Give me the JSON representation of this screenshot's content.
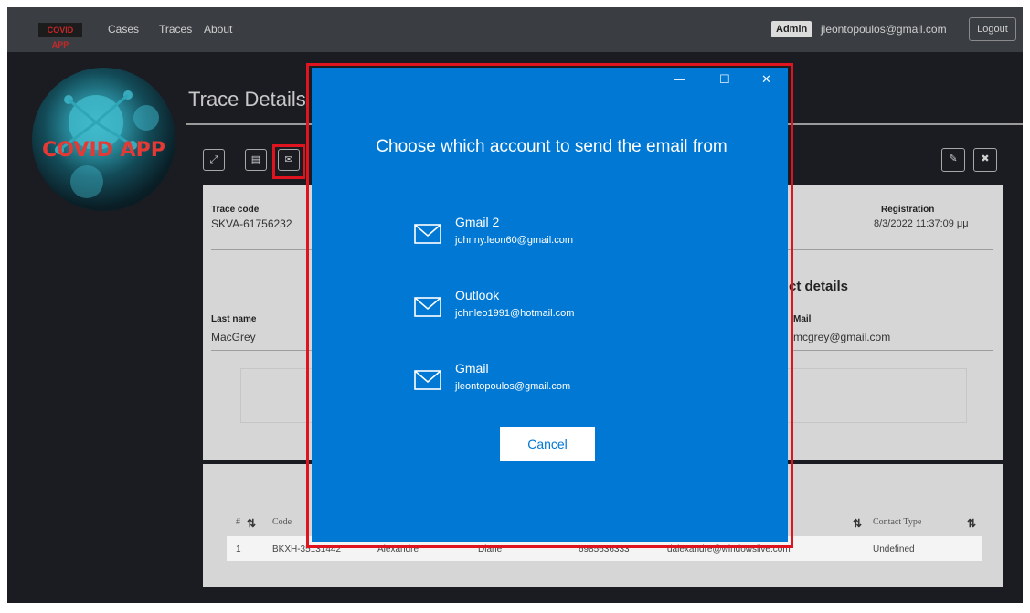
{
  "navbar": {
    "brand": "COVID APP",
    "links": [
      "Cases",
      "Traces",
      "About"
    ],
    "admin_badge": "Admin",
    "user_email": "jleontopoulos@gmail.com",
    "logout": "Logout"
  },
  "logo": {
    "text": "COVID APP"
  },
  "page": {
    "title": "Trace Details"
  },
  "toolbar": {
    "expand_icon": "expand-icon",
    "list_icon": "list-icon",
    "email_icon": "envelope-icon",
    "edit_icon": "pencil-icon",
    "close_icon": "close-icon"
  },
  "trace": {
    "code_label": "Trace code",
    "code_value": "SKVA-61756232",
    "registration_label": "Registration",
    "registration_value": "8/3/2022 11:37:09 μμ",
    "last_name_label": "Last name",
    "last_name_value": "MacGrey",
    "contact_heading": "ct details",
    "mail_label": "Mail",
    "mail_value": "mcgrey@gmail.com"
  },
  "contacts_table": {
    "headers": {
      "num": "#",
      "code": "Code",
      "contact_type": "Contact Type"
    },
    "rows": [
      {
        "num": "1",
        "code": "BKXH-35131442",
        "last_name": "Alexandre",
        "first_name": "Diane",
        "phone": "6985636333",
        "email": "dalexandre@windowslive.com",
        "contact_type": "Undefined"
      }
    ]
  },
  "modal": {
    "title": "Choose which account to send the email from",
    "accounts": [
      {
        "name": "Gmail 2",
        "email": "johnny.leon60@gmail.com"
      },
      {
        "name": "Outlook",
        "email": "johnleo1991@hotmail.com"
      },
      {
        "name": "Gmail",
        "email": "jleontopoulos@gmail.com"
      }
    ],
    "cancel": "Cancel",
    "minimize": "—",
    "maximize": "☐",
    "close": "✕"
  },
  "colors": {
    "modal_bg": "#0078d4",
    "highlight": "#e0141e",
    "navbar": "#3a3d42"
  }
}
